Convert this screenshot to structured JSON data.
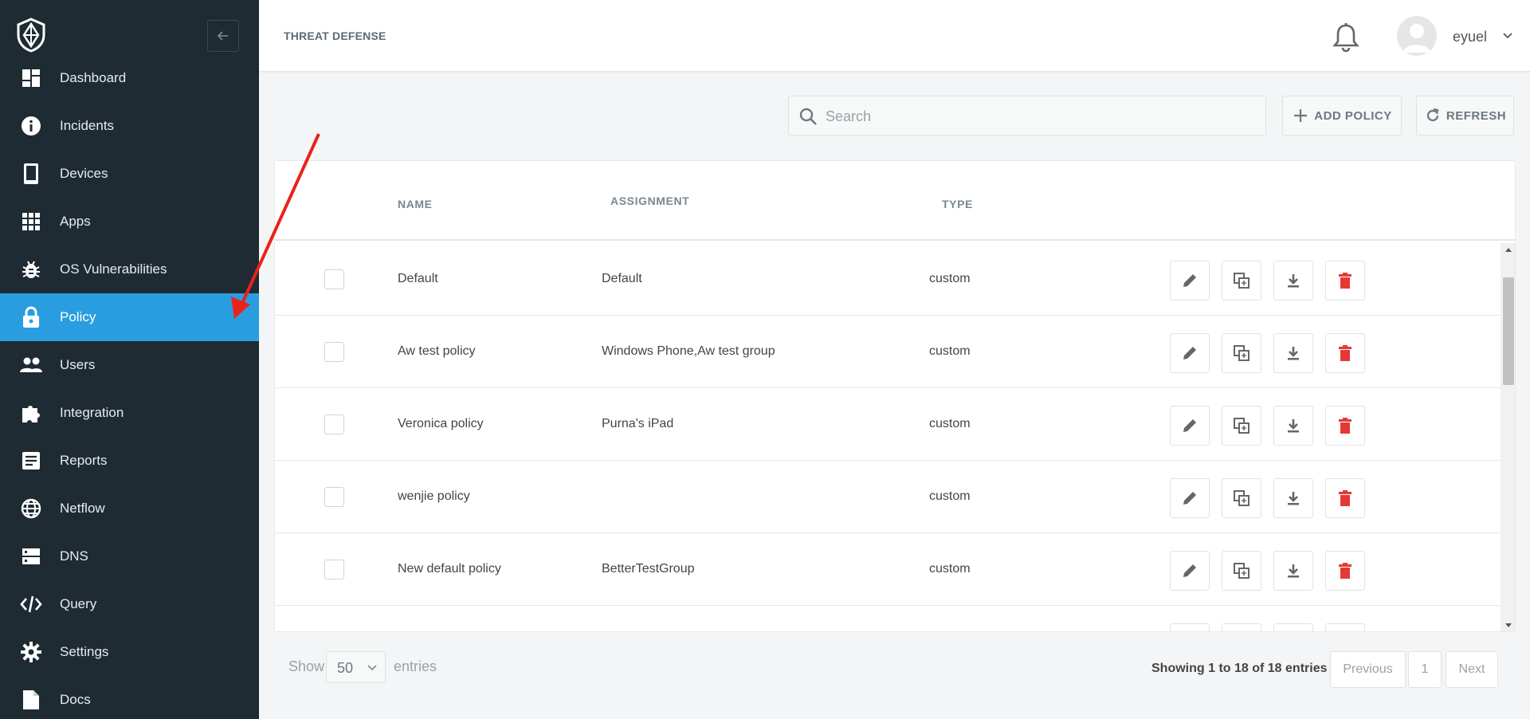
{
  "header": {
    "brand": "THREAT DEFENSE",
    "username": "eyuel"
  },
  "sidebar": {
    "items": [
      {
        "label": "Dashboard",
        "icon": "dashboard-icon"
      },
      {
        "label": "Incidents",
        "icon": "info-icon"
      },
      {
        "label": "Devices",
        "icon": "phone-icon"
      },
      {
        "label": "Apps",
        "icon": "apps-grid-icon"
      },
      {
        "label": "OS Vulnerabilities",
        "icon": "bug-icon"
      },
      {
        "label": "Policy",
        "icon": "lock-icon",
        "active": true
      },
      {
        "label": "Users",
        "icon": "users-icon"
      },
      {
        "label": "Integration",
        "icon": "puzzle-icon"
      },
      {
        "label": "Reports",
        "icon": "report-icon"
      },
      {
        "label": "Netflow",
        "icon": "globe-icon"
      },
      {
        "label": "DNS",
        "icon": "server-icon"
      },
      {
        "label": "Query",
        "icon": "code-icon"
      },
      {
        "label": "Settings",
        "icon": "gear-icon"
      },
      {
        "label": "Docs",
        "icon": "document-icon"
      }
    ]
  },
  "toolbar": {
    "search_placeholder": "Search",
    "search_value": "",
    "add_label": "ADD POLICY",
    "refresh_label": "REFRESH"
  },
  "table": {
    "columns": {
      "name": "NAME",
      "assignment": "ASSIGNMENT",
      "type": "TYPE"
    },
    "rows": [
      {
        "name": "Default",
        "assignment": "Default",
        "type": "custom"
      },
      {
        "name": "Aw test policy",
        "assignment": "Windows Phone,Aw test group",
        "type": "custom"
      },
      {
        "name": "Veronica policy",
        "assignment": "Purna's iPad",
        "type": "custom"
      },
      {
        "name": "wenjie policy",
        "assignment": "",
        "type": "custom"
      },
      {
        "name": "New default policy",
        "assignment": "BetterTestGroup",
        "type": "custom"
      },
      {
        "name": "",
        "assignment": "",
        "type": ""
      }
    ]
  },
  "footer": {
    "show_label": "Show",
    "entries_value": "50",
    "entries_label": "entries",
    "showing_text": "Showing 1 to 18 of 18 entries",
    "prev_label": "Previous",
    "page": "1",
    "next_label": "Next"
  },
  "colors": {
    "sidebar_bg": "#1e2b33",
    "active": "#2a9de0",
    "delete": "#e53935",
    "arrow": "#e8231a"
  }
}
